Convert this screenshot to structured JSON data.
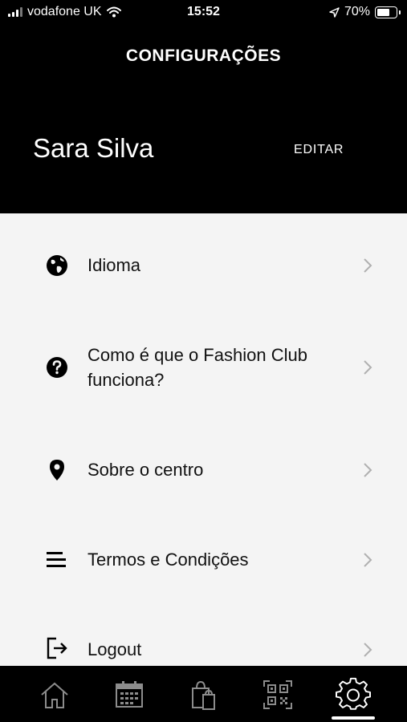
{
  "status_bar": {
    "carrier": "vodafone UK",
    "time": "15:52",
    "battery_percent": "70%",
    "battery_level": 0.7,
    "signal_icon": "signal-bars-icon",
    "wifi_icon": "wifi-icon",
    "location_icon": "location-arrow-icon"
  },
  "header": {
    "title": "CONFIGURAÇÕES",
    "user_name": "Sara Silva",
    "edit_label": "EDITAR"
  },
  "menu": {
    "items": [
      {
        "label": "Idioma",
        "icon": "globe-icon"
      },
      {
        "label_line1": "Como é que o Fashion Club",
        "label_line2": "funciona?",
        "icon": "help-circle-icon"
      },
      {
        "label": "Sobre o centro",
        "icon": "map-pin-icon"
      },
      {
        "label": "Termos e Condições",
        "icon": "list-icon"
      },
      {
        "label": "Logout",
        "icon": "logout-icon"
      }
    ]
  },
  "tab_bar": {
    "tabs": [
      {
        "name": "home",
        "icon": "home-icon"
      },
      {
        "name": "calendar",
        "icon": "calendar-icon"
      },
      {
        "name": "shopping",
        "icon": "shopping-bag-icon"
      },
      {
        "name": "qr",
        "icon": "qr-code-icon"
      },
      {
        "name": "settings",
        "icon": "gear-icon",
        "active": true
      }
    ]
  },
  "colors": {
    "header_bg": "#000000",
    "body_bg": "#f4f4f4",
    "tab_inactive": "#8c8c8c",
    "tab_active": "#ffffff",
    "chevron": "#b0b0b0"
  }
}
